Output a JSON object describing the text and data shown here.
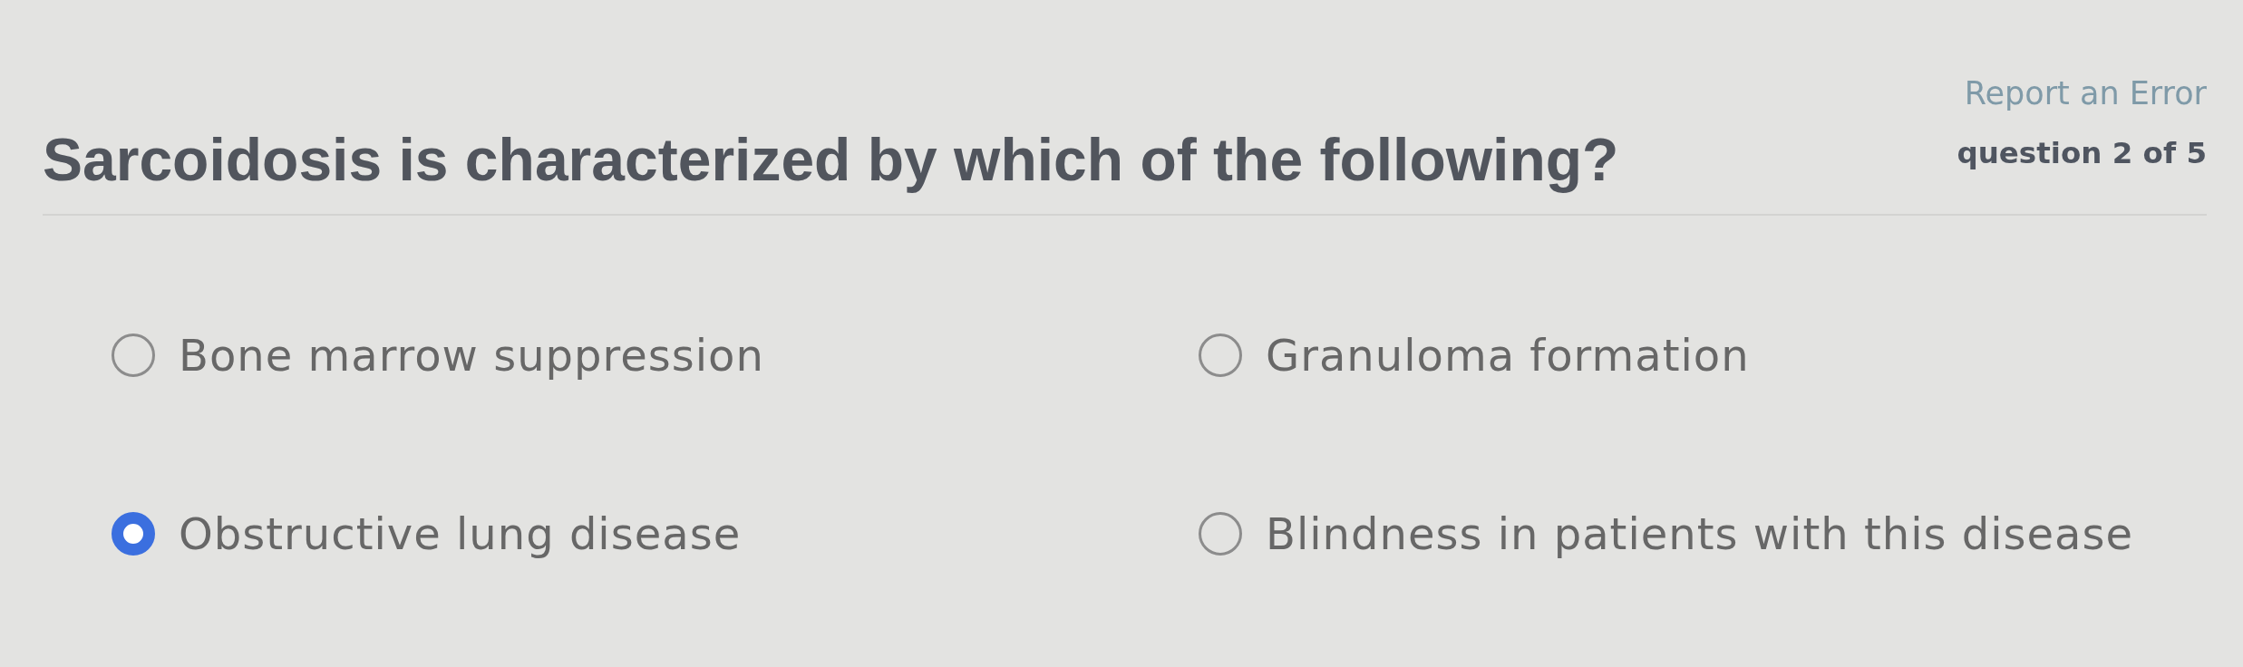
{
  "header": {
    "question": "Sarcoidosis is characterized by which of the following?",
    "report_link": "Report an Error",
    "progress": "question 2 of 5"
  },
  "options": [
    {
      "label": "Bone marrow suppression",
      "selected": false
    },
    {
      "label": "Granuloma formation",
      "selected": false
    },
    {
      "label": "Obstructive lung disease",
      "selected": true
    },
    {
      "label": "Blindness in patients with this disease",
      "selected": false
    }
  ]
}
